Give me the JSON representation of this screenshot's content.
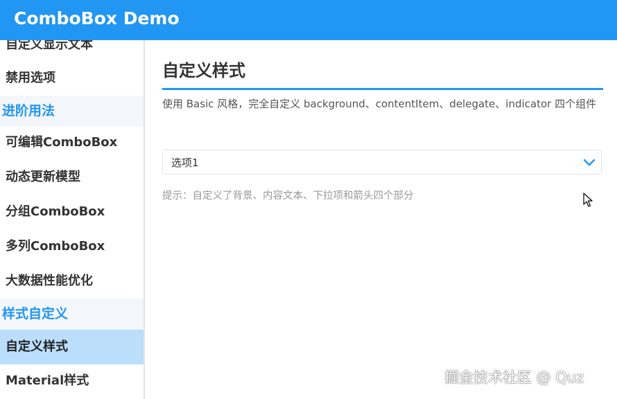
{
  "header": {
    "title": "ComboBox Demo"
  },
  "sidebar": {
    "items": [
      {
        "label": "自定义显示文本"
      },
      {
        "label": "禁用选项"
      },
      {
        "label": "进阶用法"
      },
      {
        "label": "可编辑ComboBox"
      },
      {
        "label": "动态更新模型"
      },
      {
        "label": "分组ComboBox"
      },
      {
        "label": "多列ComboBox"
      },
      {
        "label": "大数据性能优化"
      },
      {
        "label": "样式自定义"
      },
      {
        "label": "自定义样式"
      },
      {
        "label": "Material样式"
      }
    ]
  },
  "main": {
    "title": "自定义样式",
    "description": "使用 Basic 风格，完全自定义 background、contentItem、delegate、indicator 四个组件",
    "combo": {
      "value": "选项1"
    },
    "hint": "提示：自定义了背景、内容文本、下拉项和箭头四个部分"
  },
  "watermark": "掘金技术社区 @ Quz",
  "colors": {
    "accent": "#2196f3",
    "selected_bg": "#bbdefb",
    "section_bg": "#f3f6fa"
  },
  "icons": {
    "combo_indicator": "chevron-down-icon",
    "pointer": "mouse-cursor-icon"
  }
}
